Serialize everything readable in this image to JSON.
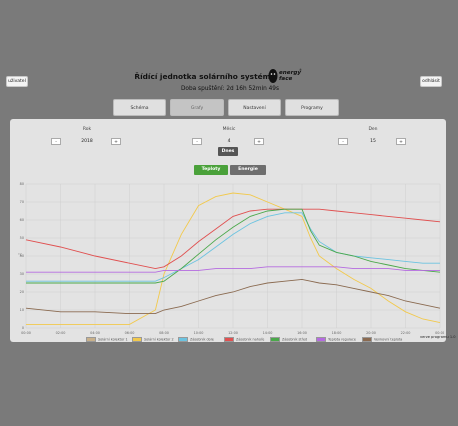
{
  "top_buttons": {
    "left": "uživatel",
    "right": "odhlásit"
  },
  "header": {
    "title": "Řídící jednotka solárního systému",
    "uptime": "Doba spuštění: 2d 16h 52min 49s",
    "logo_text_top": "energy",
    "logo_text_bottom": "face",
    "logo_sup": "®"
  },
  "nav": {
    "tabs": [
      {
        "label": "Schéma"
      },
      {
        "label": "Grafy"
      },
      {
        "label": "Nastavení"
      },
      {
        "label": "Programy"
      }
    ],
    "active": 1
  },
  "date": {
    "year": {
      "label": "Rok",
      "value": "2018"
    },
    "month": {
      "label": "Měsíc",
      "value": "4"
    },
    "day": {
      "label": "Den",
      "value": "15"
    },
    "minus": "-",
    "plus": "+",
    "today": "Dnes"
  },
  "toggles": {
    "temps": "Teploty",
    "energy": "Energie"
  },
  "legend": [
    {
      "label": "Solární kolektor 1",
      "color": "#c8b08a"
    },
    {
      "label": "Solární kolektor 2",
      "color": "#f2c94c"
    },
    {
      "label": "Zásobník dole",
      "color": "#6cc3e0"
    },
    {
      "label": "Zásobník nahoře",
      "color": "#e05050"
    },
    {
      "label": "Zásobník střed",
      "color": "#4aa84a"
    },
    {
      "label": "Teplota regulace",
      "color": "#b56be0"
    },
    {
      "label": "Venkovní teplota",
      "color": "#8a6a50"
    }
  ],
  "version": "verze programu 1.0",
  "chart_data": {
    "type": "line",
    "ylim": [
      0,
      80
    ],
    "yticks": [
      "0",
      "10",
      "20",
      "30",
      "40",
      "50",
      "60",
      "70",
      "80"
    ],
    "ylabel": "°C",
    "xticks": [
      "00:00",
      "02:00",
      "04:00",
      "06:00",
      "08:00",
      "10:00",
      "12:00",
      "14:00",
      "16:00",
      "18:00",
      "20:00",
      "22:00",
      "00:00"
    ],
    "x": [
      0,
      2,
      4,
      6,
      7.5,
      8,
      9,
      10,
      11,
      12,
      13,
      14,
      15,
      16,
      16.5,
      17,
      18,
      19,
      20,
      21,
      22,
      23,
      24
    ],
    "series": [
      {
        "name": "Solární kolektor 1",
        "color": "#c8b08a",
        "values": [
          null,
          null,
          null,
          null,
          null,
          null,
          null,
          null,
          null,
          null,
          null,
          null,
          null,
          null,
          null,
          null,
          null,
          null,
          null,
          null,
          null,
          null,
          null
        ]
      },
      {
        "name": "Solární kolektor 2",
        "color": "#f2c94c",
        "values": [
          2,
          2,
          2,
          2,
          10,
          30,
          52,
          68,
          73,
          75,
          74,
          70,
          66,
          62,
          50,
          40,
          33,
          27,
          22,
          15,
          9,
          5,
          3
        ]
      },
      {
        "name": "Zásobník dole",
        "color": "#6cc3e0",
        "values": [
          26,
          26,
          26,
          26,
          26,
          28,
          33,
          38,
          45,
          52,
          58,
          62,
          64,
          64,
          55,
          48,
          42,
          40,
          39,
          38,
          37,
          36,
          36
        ]
      },
      {
        "name": "Zásobník nahoře",
        "color": "#e05050",
        "values": [
          49,
          45,
          40,
          36,
          33,
          34,
          40,
          48,
          55,
          62,
          65,
          66,
          66,
          66,
          66,
          66,
          65,
          64,
          63,
          62,
          61,
          60,
          59
        ]
      },
      {
        "name": "Zásobník střed",
        "color": "#4aa84a",
        "values": [
          25,
          25,
          25,
          25,
          25,
          26,
          33,
          41,
          49,
          56,
          62,
          65,
          66,
          66,
          54,
          46,
          42,
          40,
          37,
          35,
          33,
          32,
          31
        ]
      },
      {
        "name": "Teplota regulace",
        "color": "#b56be0",
        "values": [
          31,
          31,
          31,
          31,
          31,
          32,
          32,
          32,
          33,
          33,
          33,
          34,
          34,
          34,
          34,
          34,
          34,
          33,
          33,
          33,
          32,
          32,
          32
        ]
      },
      {
        "name": "Venkovní teplota",
        "color": "#8a6a50",
        "values": [
          11,
          9,
          9,
          8,
          8,
          10,
          12,
          15,
          18,
          20,
          23,
          25,
          26,
          27,
          26,
          25,
          24,
          22,
          20,
          18,
          15,
          13,
          11
        ]
      }
    ]
  }
}
